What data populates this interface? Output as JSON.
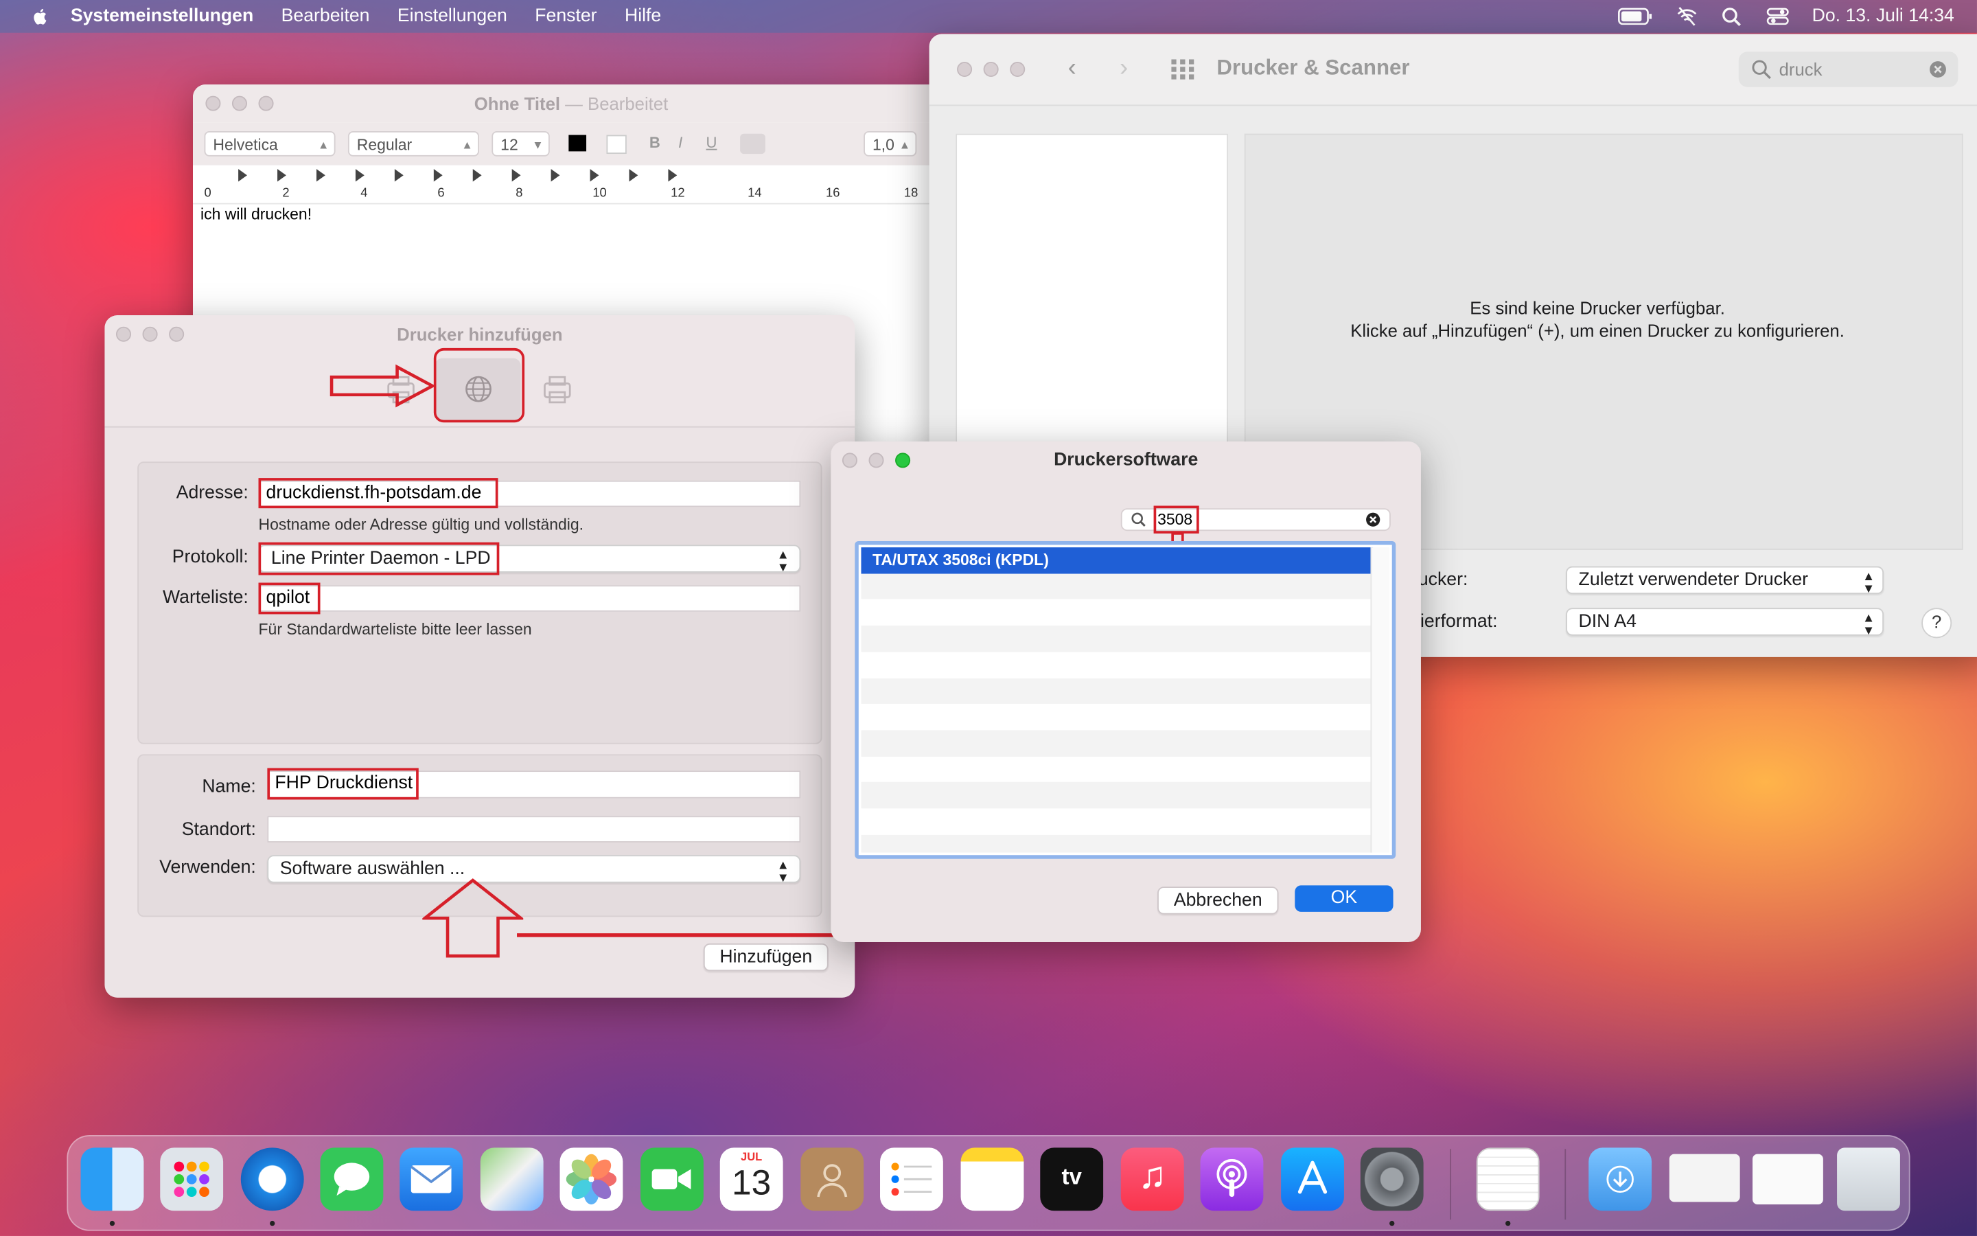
{
  "menubar": {
    "app_name": "Systemeinstellungen",
    "items": [
      "Bearbeiten",
      "Einstellungen",
      "Fenster",
      "Hilfe"
    ],
    "clock": "Do. 13. Juli  14:34"
  },
  "textedit": {
    "title": "Ohne Titel",
    "title_suffix": "— Bearbeitet",
    "font_family": "Helvetica",
    "font_style": "Regular",
    "font_size": "12",
    "line_spacing": "1,0",
    "ruler_numbers": [
      "0",
      "2",
      "4",
      "6",
      "8",
      "10",
      "12",
      "14",
      "16",
      "18"
    ],
    "document_text": "ich will drucken!"
  },
  "prefs": {
    "title": "Drucker & Scanner",
    "search_value": "druck",
    "no_printers_line1": "Es sind keine Drucker verfügbar.",
    "no_printers_line2": "Klicke auf „Hinzufügen“ (+), um einen Drucker zu konfigurieren.",
    "default_printer_label": "Standarddrucker:",
    "default_printer_value": "Zuletzt verwendeter Drucker",
    "paper_label": "Standard-Papierformat:",
    "paper_value": "DIN A4",
    "help": "?"
  },
  "add_printer": {
    "title": "Drucker hinzufügen",
    "address_label": "Adresse:",
    "address_value": "druckdienst.fh-potsdam.de",
    "address_hint": "Hostname oder Adresse gültig und vollständig.",
    "protocol_label": "Protokoll:",
    "protocol_value": "Line Printer Daemon - LPD",
    "queue_label": "Warteliste:",
    "queue_value": "qpilot",
    "queue_hint": "Für Standardwarteliste bitte leer lassen",
    "name_label": "Name:",
    "name_value": "FHP Druckdienst",
    "location_label": "Standort:",
    "location_value": "",
    "use_label": "Verwenden:",
    "use_value": "Software auswählen ...",
    "add_button": "Hinzufügen"
  },
  "driver_sheet": {
    "title": "Druckersoftware",
    "search_value": "3508",
    "selected_item": "TA/UTAX 3508ci (KPDL)",
    "cancel_button": "Abbrechen",
    "ok_button": "OK"
  },
  "dock": {
    "calendar_month": "JUL",
    "calendar_day": "13",
    "apps": [
      "finder",
      "launchpad",
      "safari",
      "messages",
      "mail",
      "maps",
      "photos",
      "facetime",
      "calendar",
      "contacts",
      "reminders",
      "notes",
      "tv",
      "music",
      "podcasts",
      "app-store",
      "system-preferences",
      "textedit",
      "downloads",
      "window-1",
      "window-2",
      "trash"
    ]
  },
  "colors": {
    "accent": "#1f5fd6",
    "highlight_red": "#d6202a"
  }
}
